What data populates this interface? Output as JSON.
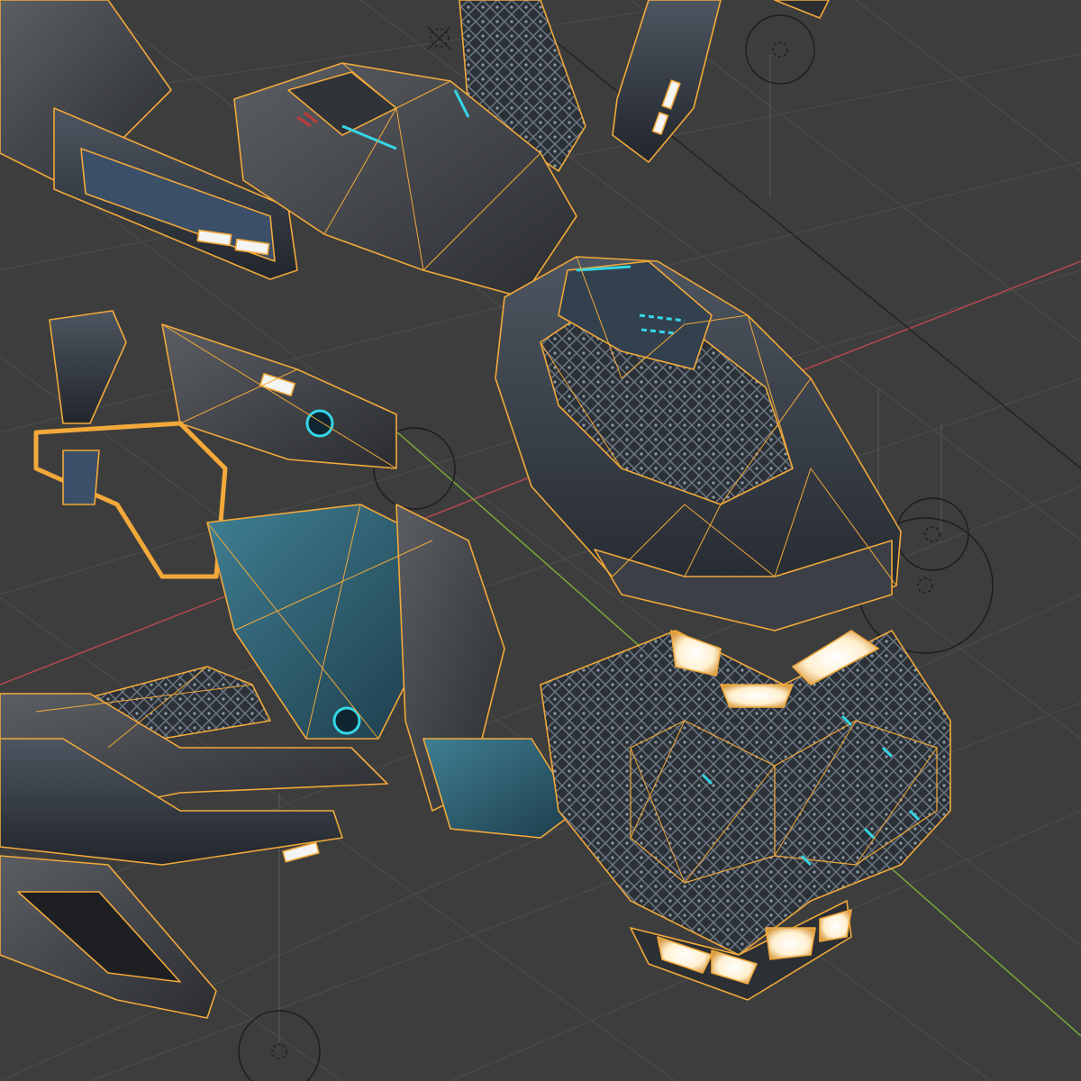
{
  "viewport": {
    "background": "#3d3d3d",
    "grid_color": "#4a4a4a",
    "x_axis_color": "#b5484f",
    "y_axis_color": "#79a83a",
    "wire_color": "#f2a93a",
    "glow_cyan": "#35d6e6",
    "light_white": "#fff6e6",
    "selection": "selected-object-wireframe"
  },
  "objects": {
    "model": "vehicle-mesh",
    "empties": [
      "empty-icon",
      "empty-icon",
      "empty-icon",
      "empty-icon",
      "empty-icon"
    ]
  }
}
